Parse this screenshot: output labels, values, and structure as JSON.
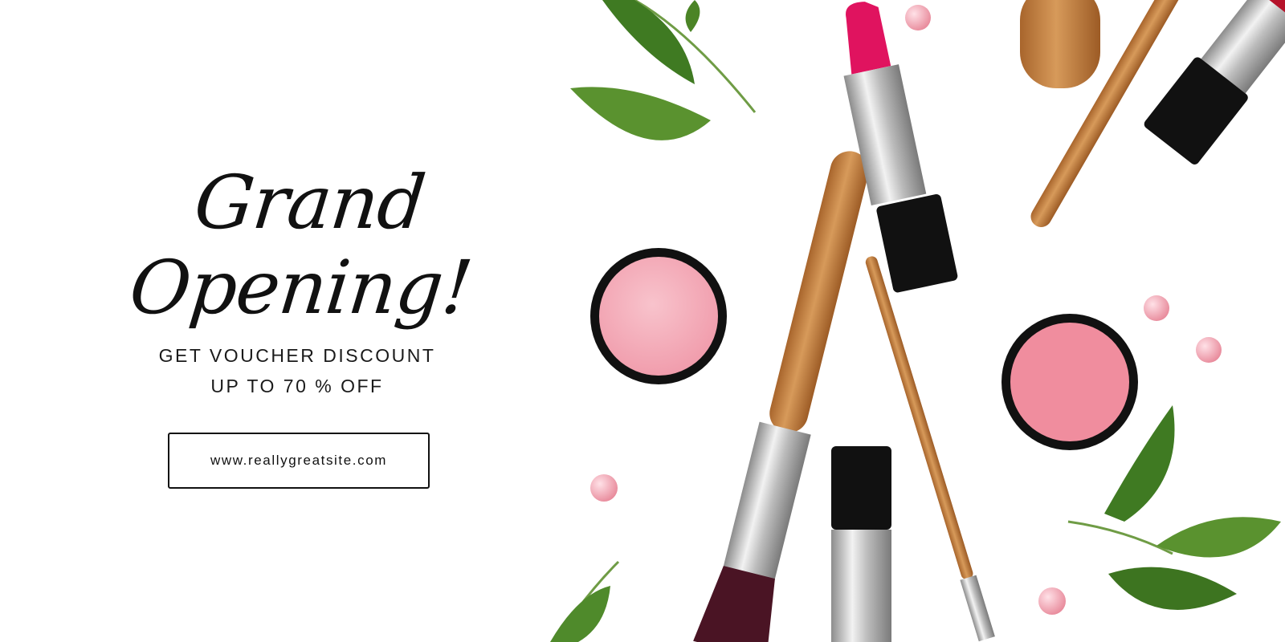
{
  "headline": "Grand Opening!",
  "offer": {
    "line1": "GET VOUCHER DISCOUNT",
    "line2": "UP TO 70 % OFF"
  },
  "cta": {
    "label": "www.reallygreatsite.com"
  },
  "colors": {
    "background": "#ffffff",
    "text": "#111111",
    "blush_pink": "#f4a9b6",
    "lipstick_magenta": "#e0135f",
    "lipstick_red": "#b5122a",
    "wood": "#c98a4a",
    "leaf_green": "#4f8a2b",
    "silver": "#c9c9c9",
    "black_case": "#121212"
  },
  "photo": {
    "subject": "cosmetics flat lay",
    "icons": [
      "lipstick-icon",
      "blush-compact-icon",
      "makeup-brush-icon",
      "leaf-icon",
      "pearl-bead-icon"
    ]
  }
}
